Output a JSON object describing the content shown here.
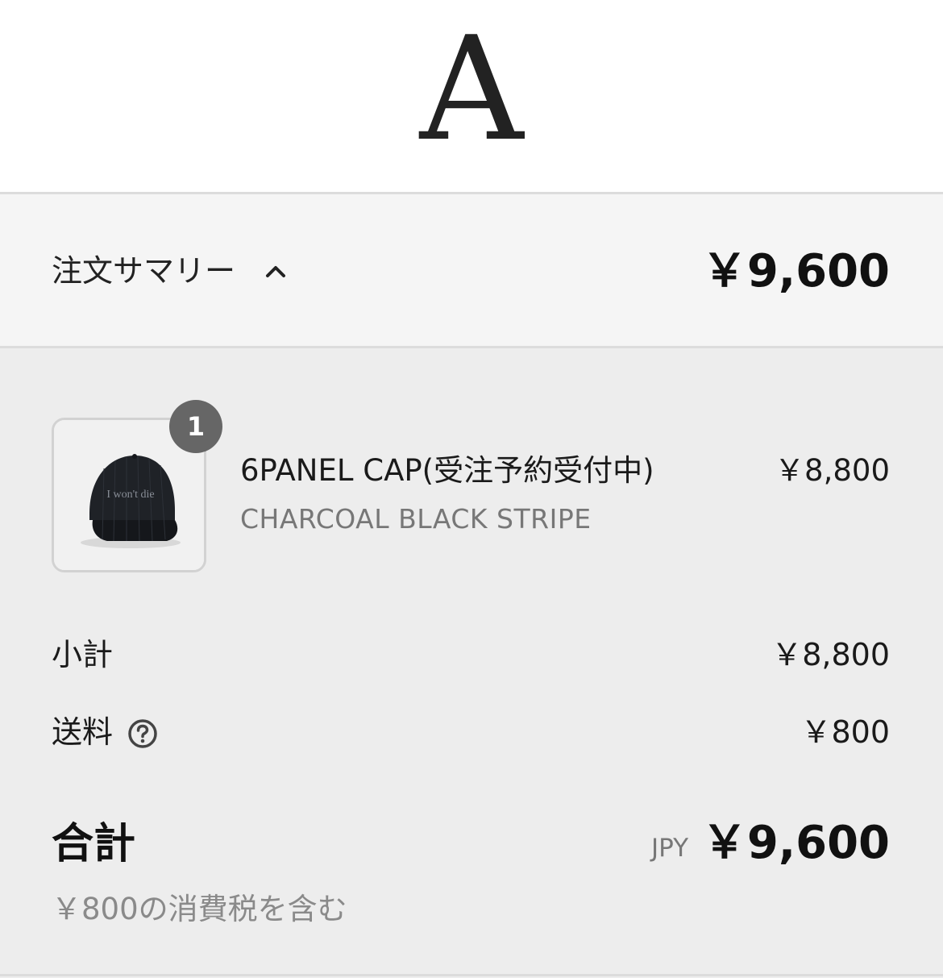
{
  "brand": {
    "logo_letter": "A"
  },
  "summary": {
    "label": "注文サマリー",
    "toggle_icon": "chevron-up-icon",
    "total": "￥9,600"
  },
  "item": {
    "quantity_badge": "1",
    "thumbnail_print": "I won't die",
    "name": "6PANEL CAP(受注予約受付中)",
    "variant": "CHARCOAL BLACK STRIPE",
    "price": "￥8,800"
  },
  "subtotal": {
    "label": "小計",
    "value": "￥8,800"
  },
  "shipping": {
    "label": "送料",
    "help_icon": "question-circle-icon",
    "value": "￥800"
  },
  "total": {
    "label": "合計",
    "currency": "JPY",
    "value": "￥9,600",
    "tax_note": "￥800の消費税を含む"
  },
  "colors": {
    "page_bg": "#ededed",
    "summary_bg": "#f5f5f5",
    "badge_bg": "#666666",
    "muted_text": "#777777"
  }
}
